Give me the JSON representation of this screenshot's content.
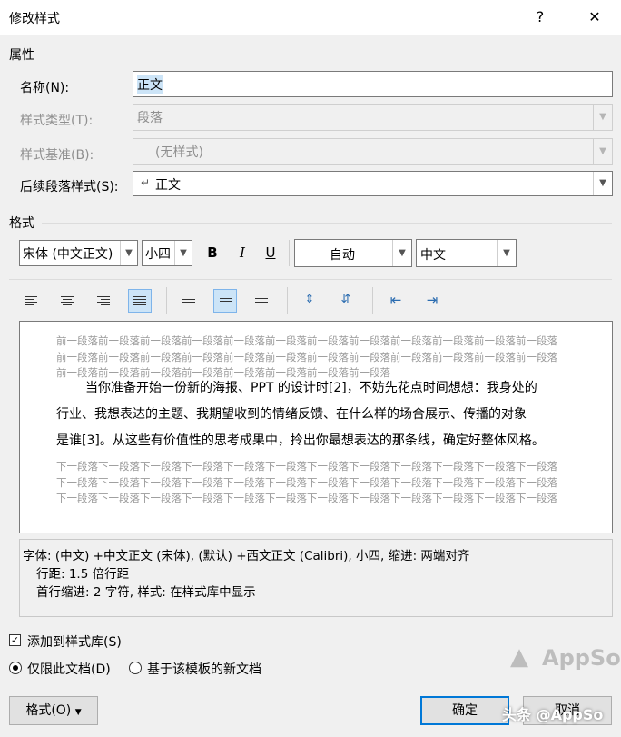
{
  "window": {
    "title": "修改样式",
    "help_glyph": "?",
    "close_glyph": "✕"
  },
  "properties": {
    "section_label": "属性",
    "name_label": "名称(N):",
    "name_value": "正文",
    "style_type_label": "样式类型(T):",
    "style_type_value": "段落",
    "style_based_on_label": "样式基准(B):",
    "style_based_on_value": "(无样式)",
    "next_style_label": "后续段落样式(S):",
    "next_style_value": "正文",
    "next_style_mark": "↵"
  },
  "format": {
    "section_label": "格式",
    "font_value": "宋体 (中文正文)",
    "size_value": "小四",
    "bold_label": "B",
    "italic_label": "I",
    "underline_label": "U",
    "color_value": "自动",
    "language_value": "中文"
  },
  "preview": {
    "prev_text": "前一段落前一段落前一段落前一段落前一段落前一段落前一段落前一段落前一段落前一段落前一段落前一段落前一段落前一段落前一段落前一段落前一段落前一段落前一段落前一段落前一段落前一段落前一段落前一段落前一段落前一段落前一段落前一段落前一段落前一段落前一段落前一段落",
    "main_line1": "当你准备开始一份新的海报、PPT 的设计时[2]，不妨先花点时间想想：我身处的",
    "main_line2": "行业、我想表达的主题、我期望收到的情绪反馈、在什么样的场合展示、传播的对象",
    "main_line3": "是谁[3]。从这些有价值性的思考成果中，拎出你最想表达的那条线，确定好整体风格。",
    "next_text": "下一段落下一段落下一段落下一段落下一段落下一段落下一段落下一段落下一段落下一段落下一段落下一段落下一段落下一段落下一段落下一段落下一段落下一段落下一段落下一段落下一段落下一段落下一段落下一段落下一段落下一段落下一段落下一段落下一段落下一段落下一段落下一段落下一段落下一段落下一段落下一段落"
  },
  "description": {
    "line1": "字体: (中文) +中文正文 (宋体), (默认) +西文正文 (Calibri), 小四, 缩进: 两端对齐",
    "line2": "行距: 1.5 倍行距",
    "line3": "首行缩进:  2 字符, 样式: 在样式库中显示"
  },
  "options": {
    "add_to_gallery_label": "添加到样式库(S)",
    "add_to_gallery_checked": true,
    "only_this_doc_label": "仅限此文档(D)",
    "new_docs_label": "基于该模板的新文档"
  },
  "buttons": {
    "format_label": "格式(O)",
    "ok_label": "确定",
    "cancel_label": "取消"
  },
  "watermark": {
    "brand": "AppSo",
    "overlay": "头条 @AppSo"
  }
}
